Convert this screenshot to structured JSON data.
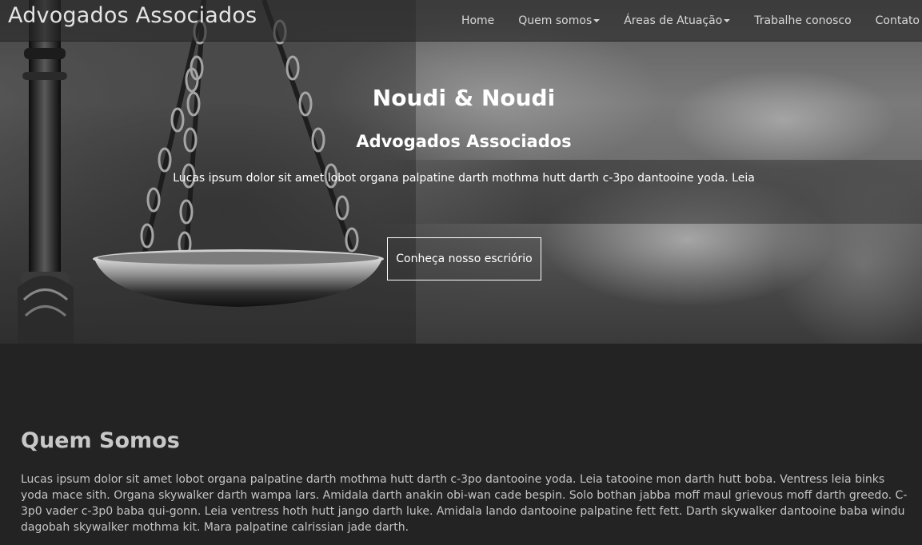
{
  "navbar": {
    "brand": "Advogados Associados",
    "items": [
      {
        "label": "Home",
        "dropdown": false
      },
      {
        "label": "Quem somos",
        "dropdown": true
      },
      {
        "label": "Áreas de Atuação",
        "dropdown": true
      },
      {
        "label": "Trabalhe conosco",
        "dropdown": false
      },
      {
        "label": "Contato",
        "dropdown": false
      }
    ]
  },
  "hero": {
    "title": "Noudi & Noudi",
    "subtitle": "Advogados Associados",
    "text": "Lucas ipsum dolor sit amet lobot organa palpatine darth mothma hutt darth c-3po dantooine yoda. Leia",
    "button_label": "Conheça nosso escriório",
    "image_icon": "scales-of-justice-icon"
  },
  "about": {
    "title": "Quem Somos",
    "text": "Lucas ipsum dolor sit amet lobot organa palpatine darth mothma hutt darth c-3po dantooine yoda. Leia tatooine mon darth hutt boba. Ventress leia binks yoda mace sith. Organa skywalker darth wampa lars. Amidala darth anakin obi-wan cade bespin. Solo bothan jabba moff maul grievous moff darth greedo. C-3p0 vader c-3p0 baba qui-gonn. Leia ventress hoth hutt jango darth luke. Amidala lando dantooine palpatine fett fett. Darth skywalker dantooine baba windu dagobah skywalker mothma kit. Mara palpatine calrissian jade darth."
  },
  "colors": {
    "navbar_bg": "#282828",
    "page_bg": "#232323",
    "text_light": "#ffffff",
    "text_muted": "#c4c4c4"
  }
}
